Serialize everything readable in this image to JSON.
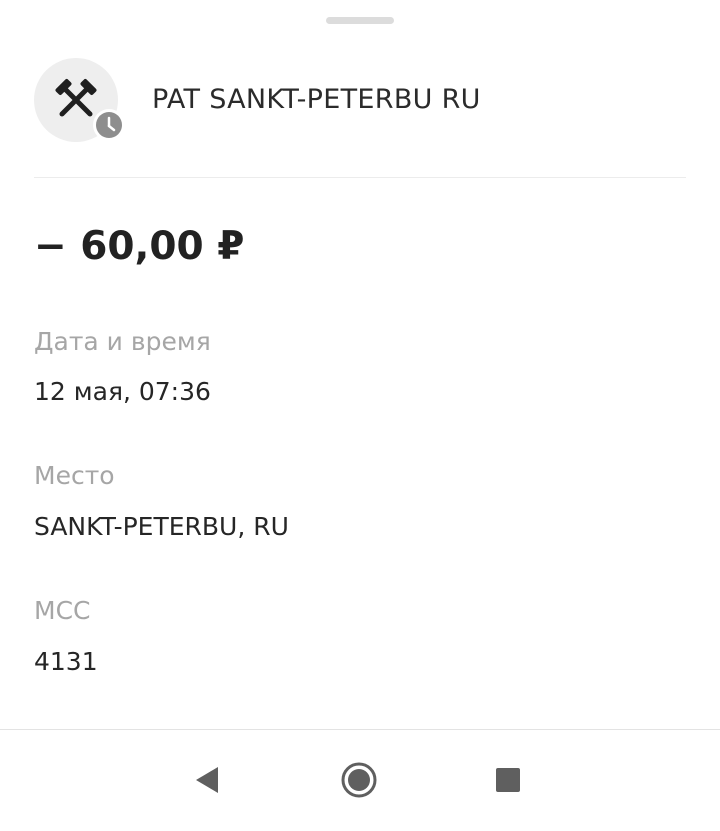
{
  "sheet": {
    "merchant": {
      "name": "PAT SANKT-PETERBU RU",
      "icon": "crossed-hammers-icon",
      "status_icon": "clock-icon"
    },
    "amount": "− 60,00 ₽",
    "fields": {
      "datetime": {
        "label": "Дата и время",
        "value": "12 мая, 07:36"
      },
      "place": {
        "label": "Место",
        "value": "SANKT-PETERBU, RU"
      },
      "mcc": {
        "label": "МСС",
        "value": "4131"
      }
    }
  },
  "navbar": {
    "back": "back-triangle-icon",
    "home": "home-circle-icon",
    "recents": "recents-square-icon"
  },
  "colors": {
    "text_primary": "#262626",
    "text_secondary": "#a6a6a6",
    "avatar_bg": "#eeeeee",
    "badge": "#8e8e8e",
    "nav_icon": "#5f5f5f"
  }
}
